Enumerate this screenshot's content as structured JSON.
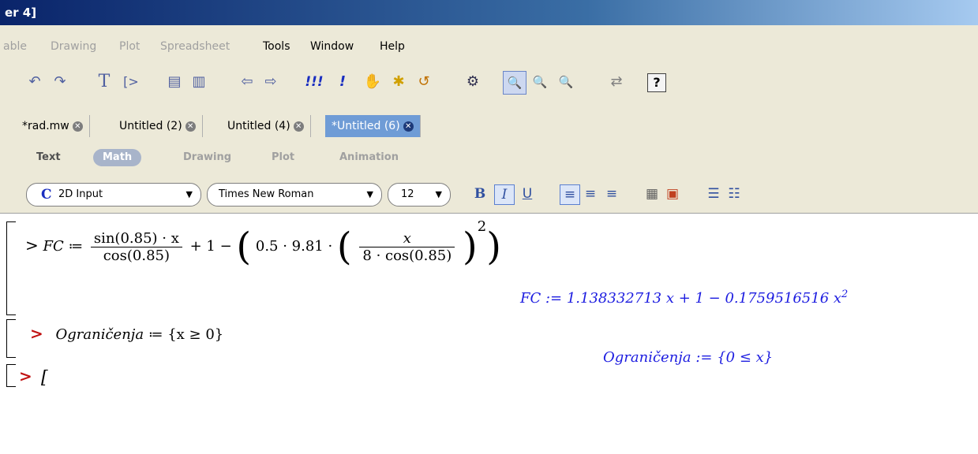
{
  "window": {
    "title": "er 4]"
  },
  "menu": {
    "items": [
      {
        "label": "able",
        "enabled": false
      },
      {
        "label": "Drawing",
        "enabled": false
      },
      {
        "label": "Plot",
        "enabled": false
      },
      {
        "label": "Spreadsheet",
        "enabled": false
      },
      {
        "label": "Tools",
        "enabled": true
      },
      {
        "label": "Window",
        "enabled": true
      },
      {
        "label": "Help",
        "enabled": true
      }
    ]
  },
  "toolbar": {
    "buttons": [
      {
        "icon": "undo-icon",
        "glyph": "↶"
      },
      {
        "icon": "redo-icon",
        "glyph": "↷"
      },
      {
        "icon": "text-mode-icon",
        "glyph": "T"
      },
      {
        "icon": "execution-group-icon",
        "glyph": "[>"
      },
      {
        "icon": "indent-icon",
        "glyph": "▤"
      },
      {
        "icon": "outdent-icon",
        "glyph": "▥"
      },
      {
        "icon": "back-arrow-icon",
        "glyph": "⇦"
      },
      {
        "icon": "forward-arrow-icon",
        "glyph": "⇨"
      },
      {
        "icon": "execute-all-icon",
        "glyph": "!!!"
      },
      {
        "icon": "execute-icon",
        "glyph": "!"
      },
      {
        "icon": "stop-icon",
        "glyph": "✋"
      },
      {
        "icon": "debug-icon",
        "glyph": "✱"
      },
      {
        "icon": "restart-icon",
        "glyph": "↺"
      },
      {
        "icon": "settings-gear-icon",
        "glyph": "⚙"
      },
      {
        "icon": "zoom-100-icon",
        "glyph": "🔍",
        "selected": true
      },
      {
        "icon": "zoom-150-icon",
        "glyph": "🔍"
      },
      {
        "icon": "zoom-200-icon",
        "glyph": "🔍"
      },
      {
        "icon": "swap-icon",
        "glyph": "⇄"
      },
      {
        "icon": "help-icon",
        "glyph": "?"
      }
    ]
  },
  "tabs": [
    {
      "label": "*rad.mw",
      "active": false
    },
    {
      "label": "Untitled (2)",
      "active": false
    },
    {
      "label": "Untitled (4)",
      "active": false
    },
    {
      "label": "*Untitled (6)",
      "active": true
    }
  ],
  "modes": [
    {
      "label": "Text",
      "active": false
    },
    {
      "label": "Math",
      "active": true
    },
    {
      "label": "Drawing",
      "active": false
    },
    {
      "label": "Plot",
      "active": false
    },
    {
      "label": "Animation",
      "active": false
    }
  ],
  "format": {
    "input_mode": {
      "icon_label": "C",
      "label": "2D Input"
    },
    "font": "Times New Roman",
    "size": "12",
    "bold": "B",
    "italic": "I",
    "underline": "U"
  },
  "worksheet": {
    "input1": {
      "prompt": ">",
      "lhs": "FC",
      "assign": "≔",
      "num1": "sin(0.85) · x",
      "den1": "cos(0.85)",
      "mid": "+ 1 −",
      "coef": "0.5 · 9.81 ·",
      "num2": "x",
      "den2": "8 · cos(0.85)",
      "exp": "2"
    },
    "output1": "FC := 1.138332713 x + 1 − 0.1759516516 x",
    "output1_exp": "2",
    "input2": {
      "prompt": ">",
      "lhs": "Ograničenja",
      "assign": "≔",
      "rhs": "{x ≥ 0}"
    },
    "output2": "Ograničenja := {0 ≤ x}",
    "input3": {
      "prompt": ">",
      "cursor": "["
    }
  }
}
